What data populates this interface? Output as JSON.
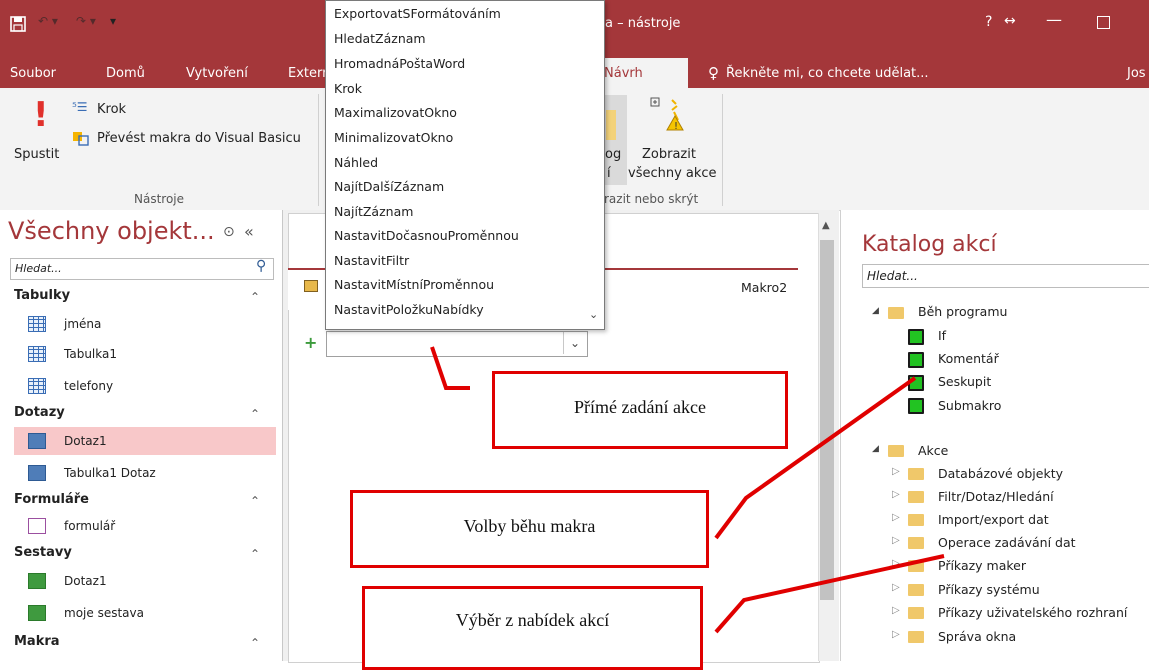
{
  "titlebar": {
    "title_fragment": "a – nástroje",
    "help": "?",
    "tabs": [
      "Soubor",
      "Domů",
      "Vytvoření",
      "Extern",
      "Návrh"
    ],
    "tellme": "Řekněte mi, co chcete udělat...",
    "user": "Jos"
  },
  "ribbon": {
    "run_label": "Spustit",
    "step_label": "Krok",
    "convert_label": "Převést makra do Visual Basicu",
    "tools_group": "Nástroje",
    "catalog_partial": "og",
    "catalog_partial2": "í",
    "show_all_label1": "Zobrazit",
    "show_all_label2": "všechny akce",
    "showhide_group": "razit nebo skrýt"
  },
  "nav": {
    "title": "Všechny objekt...",
    "search_placeholder": "Hledat...",
    "sections": [
      {
        "name": "Tabulky",
        "items": [
          "jména",
          "Tabulka1",
          "telefony"
        ]
      },
      {
        "name": "Dotazy",
        "items": [
          "Dotaz1",
          "Tabulka1 Dotaz"
        ]
      },
      {
        "name": "Formuláře",
        "items": [
          "formulář"
        ]
      },
      {
        "name": "Sestavy",
        "items": [
          "Dotaz1",
          "moje sestava"
        ]
      },
      {
        "name": "Makra",
        "items": []
      }
    ]
  },
  "editor": {
    "tab_name": "Makro2"
  },
  "dropdown": {
    "items": [
      "ExportovatSFormátováním",
      "HledatZáznam",
      "HromadnáPoštaWord",
      "Krok",
      "MaximalizovatOkno",
      "MinimalizovatOkno",
      "Náhled",
      "NajítDalšíZáznam",
      "NajítZáznam",
      "NastavitDočasnouProměnnou",
      "NastavitFiltr",
      "NastavitMístníProměnnou",
      "NastavitPoložkuNabídky"
    ]
  },
  "catalog": {
    "title": "Katalog akcí",
    "search_placeholder": "Hledat...",
    "flow_group": "Běh programu",
    "flow_items": [
      "If",
      "Komentář",
      "Seskupit",
      "Submakro"
    ],
    "actions_group": "Akce",
    "action_items": [
      "Databázové objekty",
      "Filtr/Dotaz/Hledání",
      "Import/export dat",
      "Operace zadávání dat",
      "Příkazy maker",
      "Příkazy systému",
      "Příkazy uživatelského rozhraní",
      "Správa okna"
    ]
  },
  "callouts": {
    "direct": "Přímé zadání akce",
    "flow": "Volby běhu makra",
    "menu": "Výběr z nabídek akcí"
  },
  "colors": {
    "accent": "#a4373a",
    "callout_border": "#e00000",
    "highlight": "#f8c8c9"
  }
}
